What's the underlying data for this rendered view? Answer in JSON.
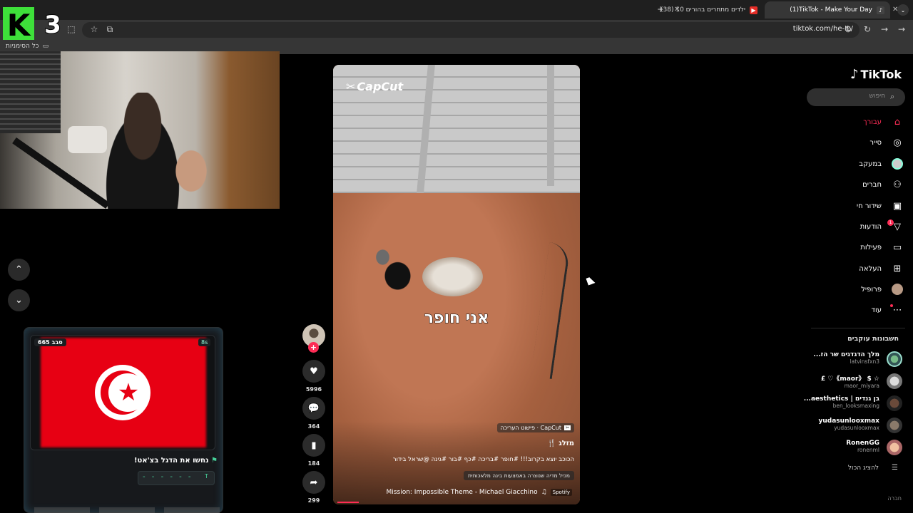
{
  "browser": {
    "tabs": [
      {
        "title": "(1)TikTok - Make Your Day",
        "active": true
      },
      {
        "title": "(38) 10 ילדים מתחרים בהורים",
        "active": false
      }
    ],
    "new_tab": "+",
    "tab_close": "✕",
    "url": "tiktok.com/he-IL/",
    "bookmarks_label": "כל הסימניות"
  },
  "overlay": {
    "logo_letter": "K",
    "logo_number": "3"
  },
  "game": {
    "round": "סבב 665",
    "timer": "8s",
    "prompt": "נחשו את הדגל בצ'אט!",
    "answer_dashes": "- - - - - -",
    "answer_hint": "T",
    "flag_color": "#e70013"
  },
  "video": {
    "watermark": "CapCut",
    "caption": "אני חופר",
    "template_tag": "CapCut · פישוט העריכה",
    "author": "מזלג 🍴",
    "description": "הכוכב יוצא בקרוב!!! #חופר #בריכה #כף #בור #גינה @שראל בידור",
    "ai_label": "מכיל מדיה שנוצרה באמצעות בינה מלאכותית",
    "music": "Mission: Impossible Theme - Michael Giacchino",
    "music_source": "Spotify"
  },
  "actions": {
    "likes": "5996",
    "comments": "364",
    "saves": "184",
    "shares": "299"
  },
  "sidebar": {
    "brand": "TikTok",
    "search_placeholder": "חיפוש",
    "nav": [
      {
        "label": "עבורך",
        "icon": "home-icon",
        "active": true
      },
      {
        "label": "סייר",
        "icon": "compass-icon"
      },
      {
        "label": "במעקב",
        "icon": "following-icon"
      },
      {
        "label": "חברים",
        "icon": "friends-icon"
      },
      {
        "label": "שידור חי",
        "icon": "live-icon"
      },
      {
        "label": "הודעות",
        "icon": "messages-icon"
      },
      {
        "label": "פעילות",
        "icon": "activity-icon"
      },
      {
        "label": "העלאה",
        "icon": "upload-icon"
      },
      {
        "label": "פרופיל",
        "icon": "profile-icon"
      },
      {
        "label": "עוד",
        "icon": "more-icon"
      }
    ],
    "notification_count": "1",
    "following_title": "חשבונות עוקבים",
    "accounts": [
      {
        "name": "מלך הדגדגים שר הז...",
        "handle": "latvinsfxn3"
      },
      {
        "name": "☆ $ 《maor》♡ £",
        "handle": "maor_miyara"
      },
      {
        "name": "בן גנדים | aesthetics...",
        "handle": "ben_looksmaxing"
      },
      {
        "name": "yudasunlooxmax",
        "handle": "yudasunlooxmax"
      },
      {
        "name": "RonenGG",
        "handle": "ronenml"
      }
    ],
    "show_all": "להציג הכול",
    "company": "חברה",
    "accent": "#fe2c55"
  }
}
